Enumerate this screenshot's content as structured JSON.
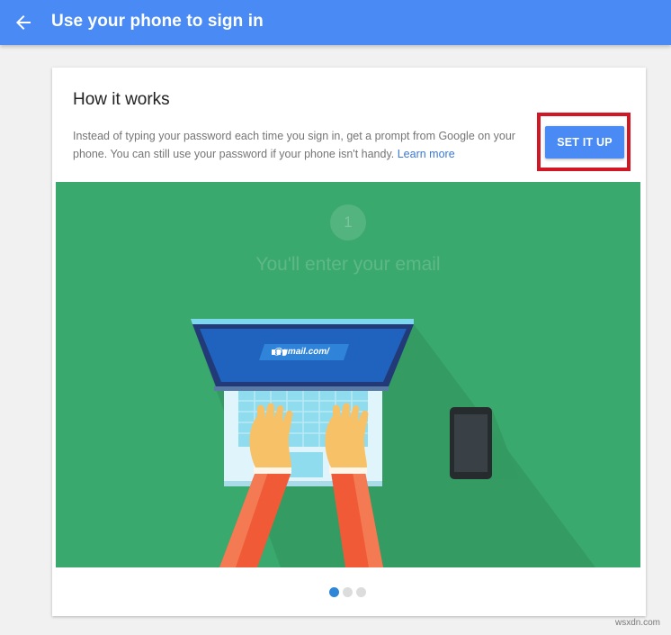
{
  "header": {
    "title": "Use your phone to sign in",
    "back_icon": "arrow-back-icon",
    "background_color": "#4a8af4"
  },
  "card": {
    "title": "How it works",
    "description": "Instead of typing your password each time you sign in, get a prompt from Google on your phone. You can still use your password if your phone isn't handy. ",
    "learn_more_label": "Learn more",
    "setup_button_label": "SET IT UP",
    "highlight_color": "#d31623"
  },
  "illustration": {
    "step_number": "1",
    "step_title": "You'll enter your email",
    "email_text": "@gmail.com/",
    "background_color": "#3aa96d"
  },
  "pagination": {
    "total": 3,
    "active_index": 0
  },
  "watermark": "wsxdn.com"
}
